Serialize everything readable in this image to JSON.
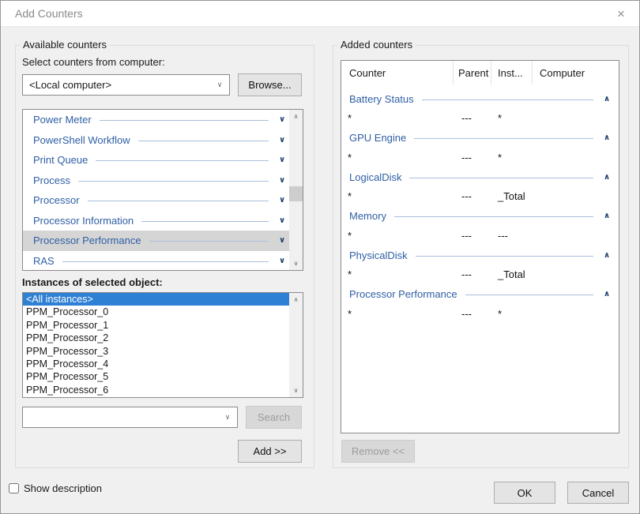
{
  "window": {
    "title": "Add Counters"
  },
  "icons": {
    "close": "×",
    "chevron_down": "∨",
    "chevron_up": "∧",
    "scroll_up": "∧",
    "scroll_down": "∨"
  },
  "available": {
    "group_label": "Available counters",
    "select_computer_label": "Select counters from computer:",
    "computer_value": "<Local computer>",
    "browse_button": "Browse...",
    "counters": [
      {
        "name": "Power Meter",
        "selected": false
      },
      {
        "name": "PowerShell Workflow",
        "selected": false
      },
      {
        "name": "Print Queue",
        "selected": false
      },
      {
        "name": "Process",
        "selected": false
      },
      {
        "name": "Processor",
        "selected": false
      },
      {
        "name": "Processor Information",
        "selected": false
      },
      {
        "name": "Processor Performance",
        "selected": true
      },
      {
        "name": "RAS",
        "selected": false
      }
    ],
    "instances_label": "Instances of selected object:",
    "instances": [
      "<All instances>",
      "PPM_Processor_0",
      "PPM_Processor_1",
      "PPM_Processor_2",
      "PPM_Processor_3",
      "PPM_Processor_4",
      "PPM_Processor_5",
      "PPM_Processor_6"
    ],
    "selected_instance_index": 0,
    "search_value": "",
    "search_button": "Search",
    "add_button": "Add >>"
  },
  "added": {
    "group_label": "Added counters",
    "columns": [
      "Counter",
      "Parent",
      "Inst...",
      "Computer"
    ],
    "groups": [
      {
        "name": "Battery Status",
        "counter": "*",
        "parent": "---",
        "inst": "*",
        "computer": ""
      },
      {
        "name": "GPU Engine",
        "counter": "*",
        "parent": "---",
        "inst": "*",
        "computer": ""
      },
      {
        "name": "LogicalDisk",
        "counter": "*",
        "parent": "---",
        "inst": "_Total",
        "computer": ""
      },
      {
        "name": "Memory",
        "counter": "*",
        "parent": "---",
        "inst": "---",
        "computer": ""
      },
      {
        "name": "PhysicalDisk",
        "counter": "*",
        "parent": "---",
        "inst": "_Total",
        "computer": ""
      },
      {
        "name": "Processor Performance",
        "counter": "*",
        "parent": "---",
        "inst": "*",
        "computer": ""
      }
    ],
    "remove_button": "Remove <<"
  },
  "footer": {
    "show_description": "Show description",
    "ok_button": "OK",
    "cancel_button": "Cancel"
  },
  "colors": {
    "background": "#f0f0f0",
    "accent_blue": "#2f5fa5",
    "chevron_navy": "#1c3e6e",
    "selection_blue": "#2e80d4",
    "line_blue": "#aabfdc",
    "disabled_text": "#9c9c9c"
  }
}
